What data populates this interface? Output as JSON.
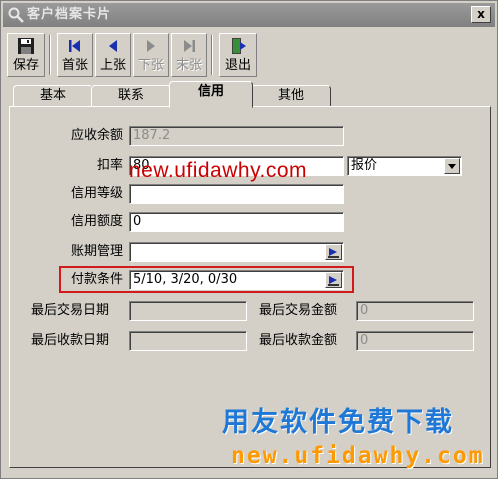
{
  "window": {
    "title": "客户档案卡片",
    "close_label": "x"
  },
  "toolbar": [
    {
      "label": "保存",
      "enabled": true
    },
    {
      "label": "首张",
      "enabled": true
    },
    {
      "label": "上张",
      "enabled": true
    },
    {
      "label": "下张",
      "enabled": false
    },
    {
      "label": "末张",
      "enabled": false
    },
    {
      "label": "退出",
      "enabled": true
    }
  ],
  "tabs": [
    {
      "label": "基本",
      "active": false
    },
    {
      "label": "联系",
      "active": false
    },
    {
      "label": "信用",
      "active": true
    },
    {
      "label": "其他",
      "active": false
    }
  ],
  "form": {
    "receivable_balance": {
      "label": "应收余额",
      "value": "187.2"
    },
    "discount_rate": {
      "label": "扣率",
      "value": "80"
    },
    "price_type": {
      "value": "报价"
    },
    "credit_level": {
      "label": "信用等级",
      "value": ""
    },
    "credit_limit": {
      "label": "信用额度",
      "value": "0"
    },
    "account_period": {
      "label": "账期管理",
      "value": ""
    },
    "payment_terms": {
      "label": "付款条件",
      "value": "5/10, 3/20, 0/30"
    },
    "last_trade_date": {
      "label": "最后交易日期",
      "value": ""
    },
    "last_trade_amount": {
      "label": "最后交易金额",
      "value": "0"
    },
    "last_receipt_date": {
      "label": "最后收款日期",
      "value": ""
    },
    "last_receipt_amount": {
      "label": "最后收款金额",
      "value": "0"
    }
  },
  "watermark": {
    "url_top": "new.ufidawhy.com",
    "brand": "用友软件免费下载",
    "url_bottom": "new.ufidawhy.com"
  },
  "colors": {
    "highlight": "#d11a1a",
    "brand_blue": "#1f78d6",
    "brand_orange": "#ff9900",
    "toolbar_blue": "#1a2fb0"
  }
}
